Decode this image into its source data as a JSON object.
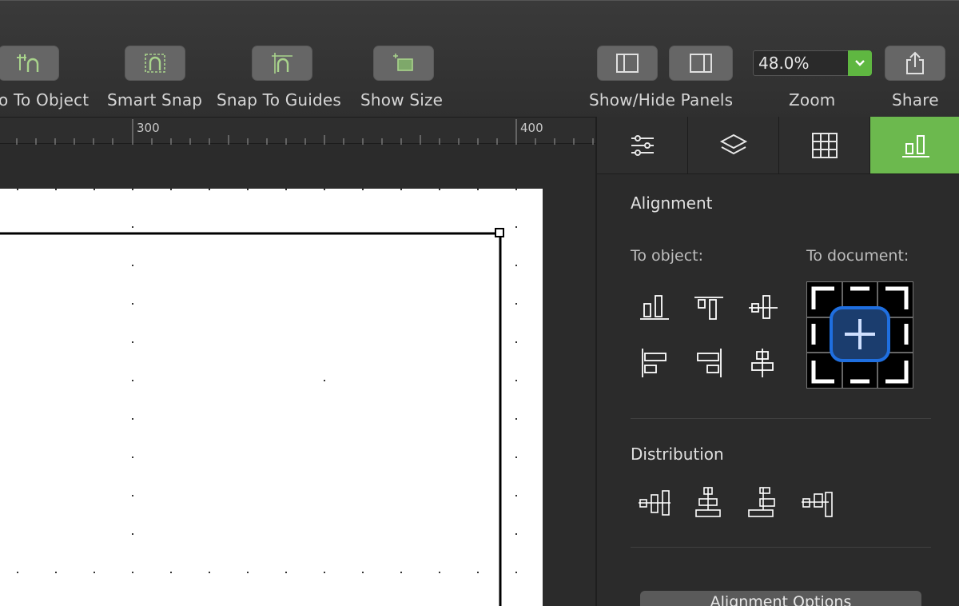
{
  "toolbar": {
    "snap_to_object": "o To Object",
    "smart_snap": "Smart Snap",
    "snap_to_guides": "Snap To Guides",
    "show_size": "Show Size",
    "show_hide_panels": "Show/Hide Panels",
    "zoom_label": "Zoom",
    "zoom_value": "48.0%",
    "share": "Share"
  },
  "ruler": {
    "marks": [
      "300",
      "400"
    ]
  },
  "panel": {
    "tabs": [
      "settings-sliders-icon",
      "layers-icon",
      "grid-icon",
      "alignment-icon"
    ],
    "alignment_title": "Alignment",
    "to_object": "To object:",
    "to_document": "To document:",
    "distribution_title": "Distribution",
    "alignment_options": "Alignment Options"
  },
  "colors": {
    "accent_green": "#6cb94e",
    "selection_blue": "#1f6fe0"
  }
}
